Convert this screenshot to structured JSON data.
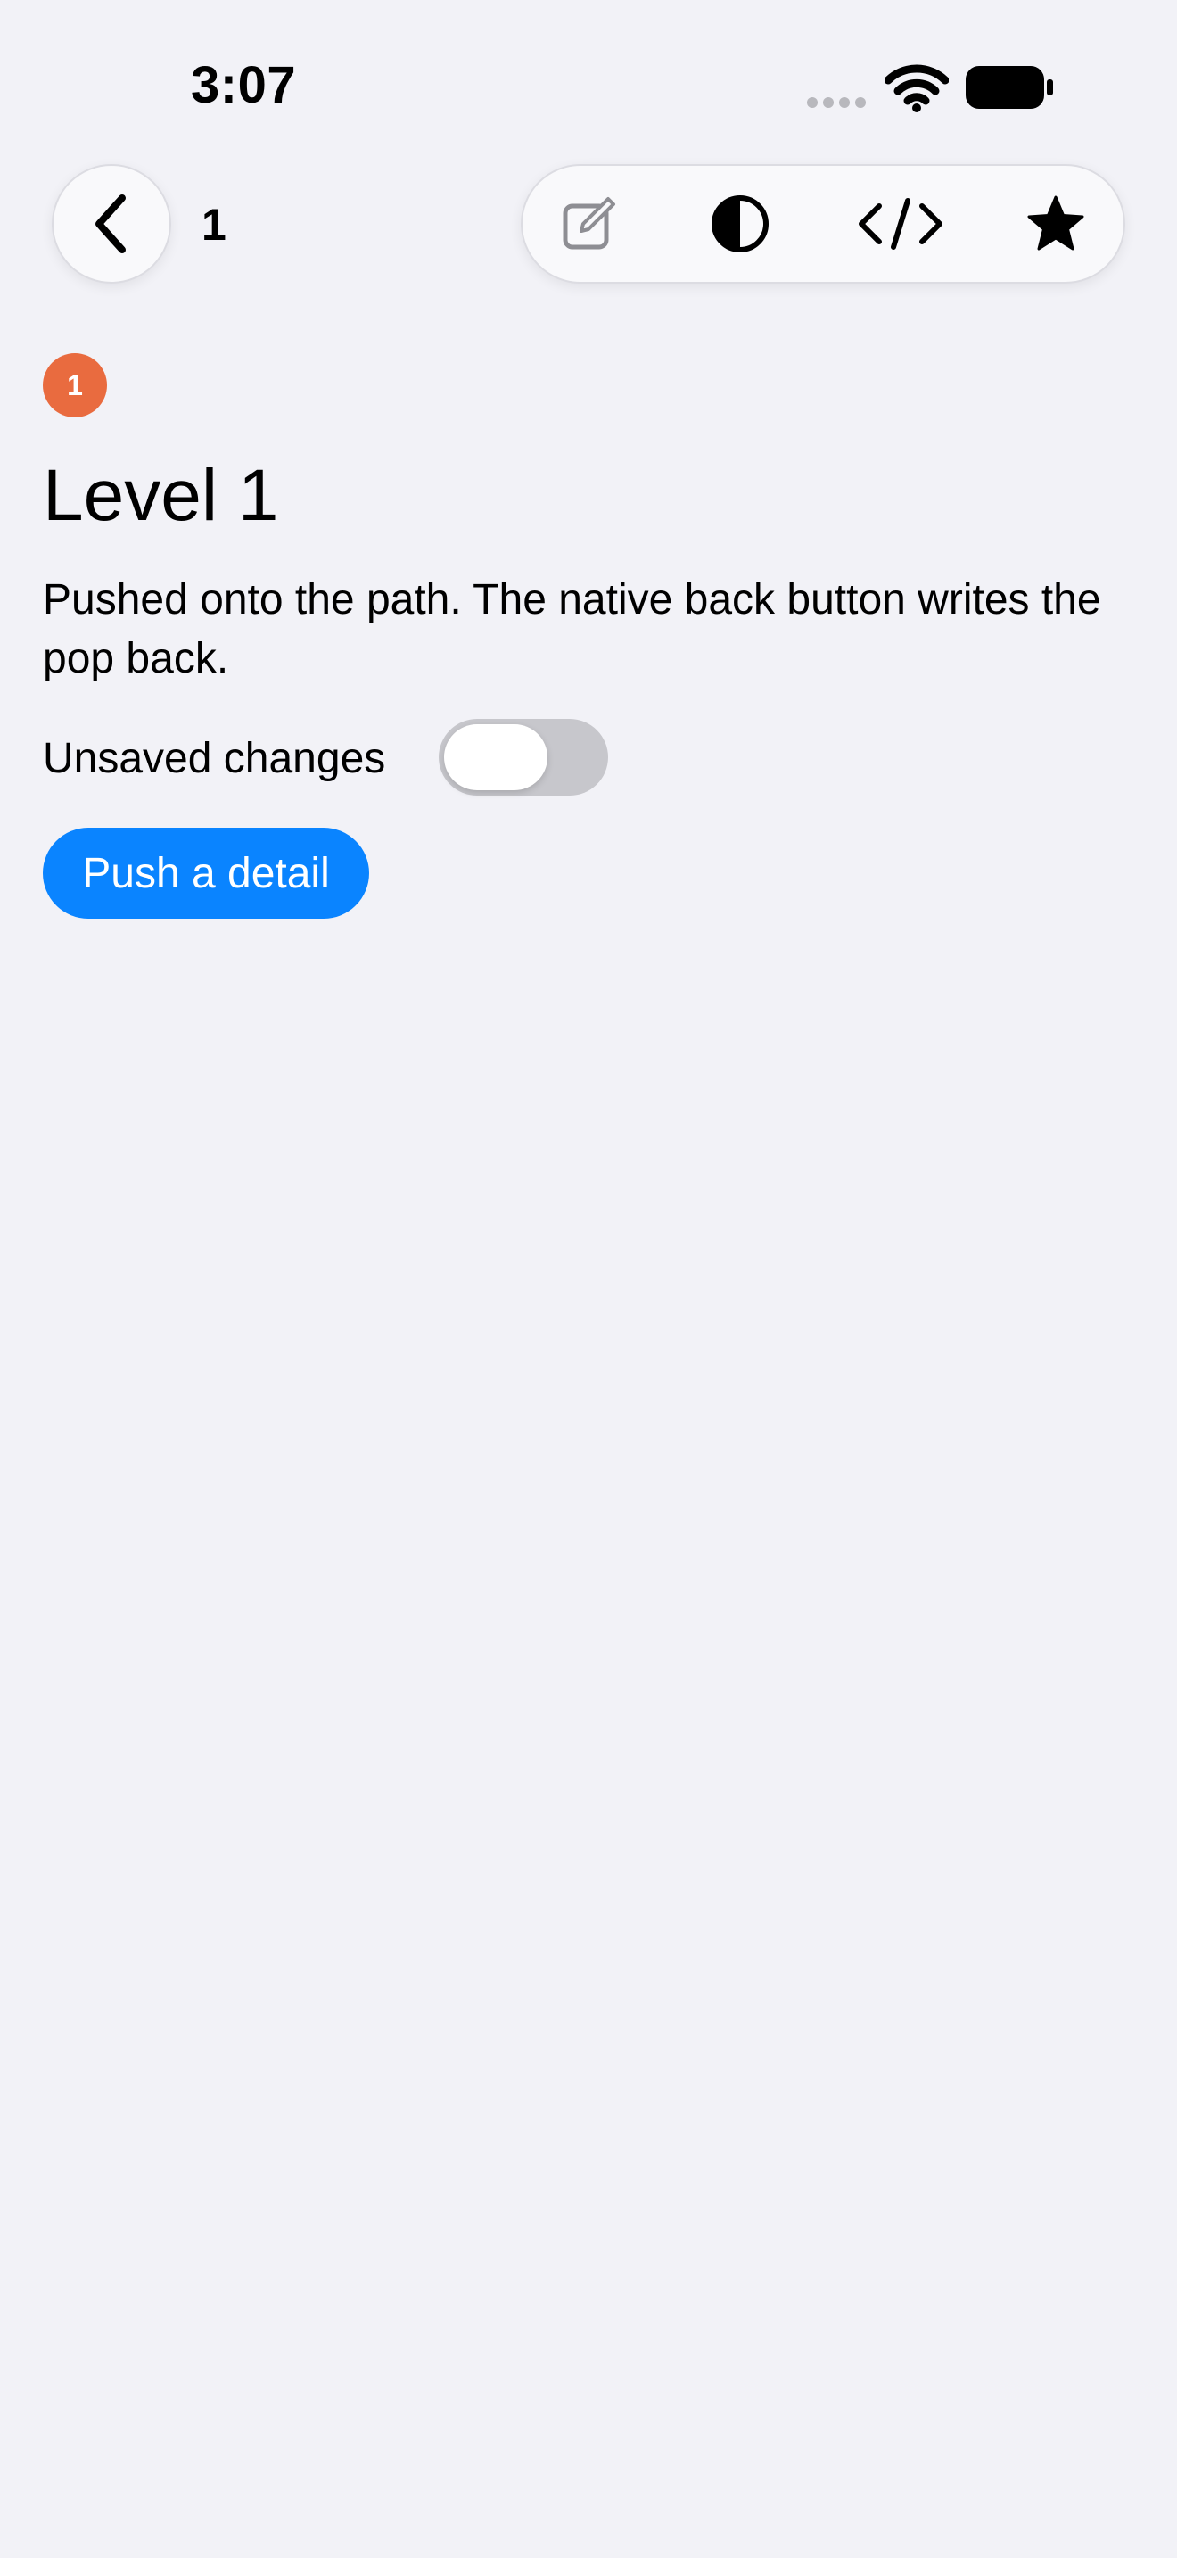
{
  "status_bar": {
    "time": "3:07",
    "icons": [
      "cellular-signal-icon",
      "wifi-icon",
      "battery-icon"
    ]
  },
  "nav": {
    "back_icon": "chevron-left-icon",
    "title": "1",
    "toolbar": [
      {
        "icon": "compose-icon",
        "state": "disabled"
      },
      {
        "icon": "contrast-icon"
      },
      {
        "icon": "code-icon"
      },
      {
        "icon": "star-icon"
      }
    ]
  },
  "content": {
    "badge": "1",
    "title": "Level 1",
    "description": "Pushed onto the path. The native back button writes the pop back.",
    "toggle": {
      "label": "Unsaved changes",
      "on": false
    },
    "push_button": "Push a detail"
  },
  "colors": {
    "background": "#f2f2f7",
    "accent": "#0a84ff",
    "badge": "#e96b3f",
    "toggle_off": "#c7c7cc"
  }
}
